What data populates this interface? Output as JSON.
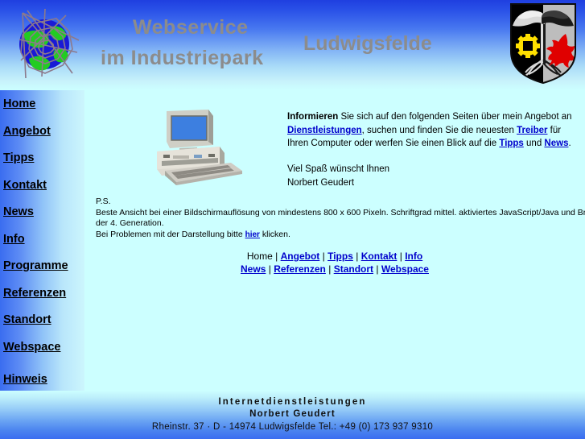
{
  "header": {
    "title_line1": "Webservice",
    "title_line2": "im Industriepark",
    "title_right": "Ludwigsfelde",
    "logo_icon": "globe-spiderweb-icon",
    "crest_icon": "coat-of-arms-ludwigsfelde-icon",
    "title_color": "#8c8c8c",
    "gradient_top": "#1f3fe0",
    "gradient_bottom": "#ccffff"
  },
  "sidebar": {
    "items": [
      {
        "label": "Home"
      },
      {
        "label": "Angebot"
      },
      {
        "label": "Tipps"
      },
      {
        "label": "Kontakt"
      },
      {
        "label": "News"
      },
      {
        "label": "Info"
      },
      {
        "label": "Programme"
      },
      {
        "label": "Referenzen"
      },
      {
        "label": "Standort"
      },
      {
        "label": "Webspace"
      },
      {
        "label": "Hinweis"
      }
    ],
    "link_color": "#000000"
  },
  "main": {
    "pc_icon": "desktop-computer-icon",
    "intro": {
      "lead": "Informieren",
      "t1": " Sie sich auf den folgenden Seiten über mein Angebot an ",
      "link1": "Dienstleistungen",
      "t2": ", suchen und finden Sie die neuesten ",
      "link2": "Treiber",
      "t3": " für Ihren Computer oder werfen Sie einen Blick auf die ",
      "link3": "Tipps",
      "t4": " und ",
      "link4": "News",
      "t5": "."
    },
    "signoff_line1": "Viel Spaß wünscht Ihnen",
    "signoff_line2": "Norbert Geudert",
    "ps": {
      "label": "P.S.",
      "line1": "Beste Ansicht bei einer Bildschirmauflösung von mindestens 800 x 600 Pixeln. Schriftgrad mittel. aktiviertes JavaScript/Java und Browser ab",
      "line2": "der 4. Generation.",
      "line3_pre": "Bei Problemen mit der Darstellung bitte ",
      "line3_link": "hier",
      "line3_post": " klicken."
    },
    "footnav": {
      "row1": [
        {
          "label": "Home",
          "link": false
        },
        {
          "label": "Angebot",
          "link": true
        },
        {
          "label": "Tipps",
          "link": true
        },
        {
          "label": "Kontakt",
          "link": true
        },
        {
          "label": "Info",
          "link": true
        }
      ],
      "row2": [
        {
          "label": "News",
          "link": true
        },
        {
          "label": "Referenzen",
          "link": true
        },
        {
          "label": "Standort",
          "link": true
        },
        {
          "label": "Webspace",
          "link": true
        }
      ],
      "separator": "|"
    },
    "link_color": "#0000cc"
  },
  "footer": {
    "line1": "Internetdienstleistungen",
    "line2": "Norbert Geudert",
    "line3": "Rheinstr. 37 · D - 14974 Ludwigsfelde Tel.: +49 (0) 173 937 9310"
  },
  "colors": {
    "page_bg": "#ccffff",
    "accent_blue": "#3a6df0"
  }
}
